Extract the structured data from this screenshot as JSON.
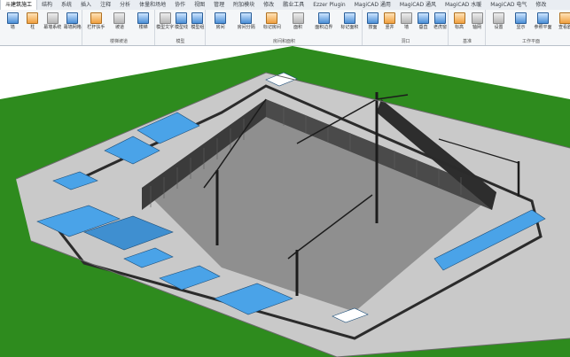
{
  "ribbon": {
    "tabs": [
      "斗建筑施工",
      "结构",
      "系统",
      "插入",
      "注释",
      "分析",
      "体量和场地",
      "协作",
      "视图",
      "管理",
      "附加模块",
      "修改",
      "鹏业工具",
      "Ezzer Plugin",
      "MagiCAD 通用",
      "MagiCAD 通风",
      "MagiCAD 水暖",
      "MagiCAD 电气",
      "修改"
    ],
    "active_tab_index": 0,
    "groups": [
      {
        "label": "",
        "buttons": [
          "墙",
          "柱",
          "幕墙系统",
          "幕墙网格"
        ]
      },
      {
        "label": "楼梯坡道",
        "buttons": [
          "栏杆扶手",
          "坡道",
          "楼梯"
        ]
      },
      {
        "label": "模型",
        "buttons": [
          "模型文字",
          "模型线",
          "模型组"
        ]
      },
      {
        "label": "房间和面积",
        "buttons": [
          "房间",
          "房间分隔",
          "标记房间",
          "面积",
          "面积边界",
          "标记面积"
        ]
      },
      {
        "label": "洞口",
        "buttons": [
          "按面",
          "竖井",
          "墙",
          "垂直",
          "老虎窗"
        ]
      },
      {
        "label": "基准",
        "buttons": [
          "标高",
          "轴网"
        ]
      },
      {
        "label": "工作平面",
        "buttons": [
          "设置",
          "显示",
          "参照平面",
          "查看器"
        ]
      }
    ]
  },
  "colors": {
    "ribbon_bg": "#f4f6f8",
    "grass": "#2e8b1e",
    "site_floor": "#a9a9a9",
    "wall_dark": "#3b3b3b",
    "building_blue": "#4aa3e8",
    "crane_dark": "#1c1c1c"
  }
}
